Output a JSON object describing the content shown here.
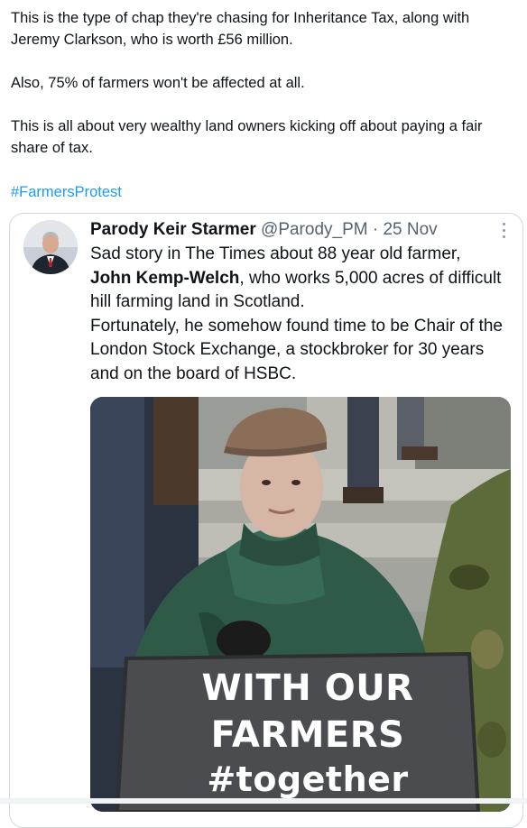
{
  "post": {
    "paragraphs": [
      "This is the type of chap they're chasing for Inheritance Tax, along with Jeremy Clarkson, who is worth £56 million.",
      "Also, 75% of farmers won't be affected at all.",
      "This is all about very wealthy land owners kicking off about paying a fair share of tax."
    ],
    "hashtag": "#FarmersProtest"
  },
  "quoted": {
    "display_name": "Parody Keir Starmer",
    "handle": "@Parody_PM",
    "separator": "·",
    "date": "25 Nov",
    "text_line1": "Sad story in The Times about 88 year old farmer,",
    "text_bold": "John Kemp-Welch",
    "text_line2_rest": ", who works 5,000 acres of difficult hill farming land in Scotland.",
    "text_para2": "Fortunately, he somehow found time to be Chair of the London Stock Exchange, a stockbroker for 30 years and on the board of HSBC.",
    "sign": {
      "line1": "WITH OUR",
      "line2": "FARMERS",
      "line3": "#together"
    }
  },
  "colors": {
    "link": "#1d9bf0",
    "text": "#0f1419",
    "secondary": "#536471",
    "border": "#cfd9de"
  },
  "icons": {
    "more": "more-options-icon"
  }
}
